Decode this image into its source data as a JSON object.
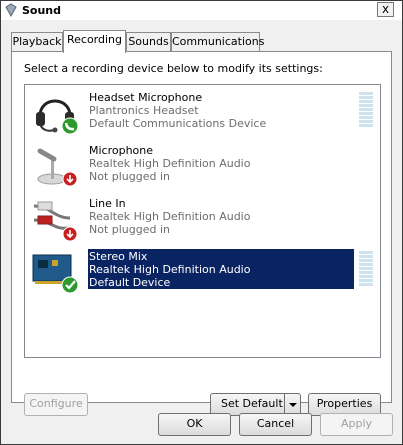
{
  "window": {
    "title": "Sound",
    "close_label": "x"
  },
  "tabs": [
    {
      "label": "Playback"
    },
    {
      "label": "Recording"
    },
    {
      "label": "Sounds"
    },
    {
      "label": "Communications"
    }
  ],
  "active_tab": "Recording",
  "instruction": "Select a recording device below to modify its settings:",
  "devices": [
    {
      "name": "Headset Microphone",
      "driver": "Plantronics Headset",
      "status": "Default Communications Device",
      "icon": "headset-icon",
      "badge": "phone-badge",
      "selected": false
    },
    {
      "name": "Microphone",
      "driver": "Realtek High Definition Audio",
      "status": "Not plugged in",
      "icon": "microphone-icon",
      "badge": "down-arrow-badge",
      "selected": false
    },
    {
      "name": "Line In",
      "driver": "Realtek High Definition Audio",
      "status": "Not plugged in",
      "icon": "rca-cable-icon",
      "badge": "down-arrow-badge",
      "selected": false
    },
    {
      "name": "Stereo Mix",
      "driver": "Realtek High Definition Audio",
      "status": "Default Device",
      "icon": "sound-card-icon",
      "badge": "check-badge",
      "selected": true
    }
  ],
  "buttons": {
    "configure": "Configure",
    "set_default": "Set Default",
    "properties": "Properties",
    "ok": "OK",
    "cancel": "Cancel",
    "apply": "Apply"
  },
  "colors": {
    "selection": "#0a2463",
    "badge_green": "#2e9a2e",
    "badge_red": "#c62020"
  }
}
